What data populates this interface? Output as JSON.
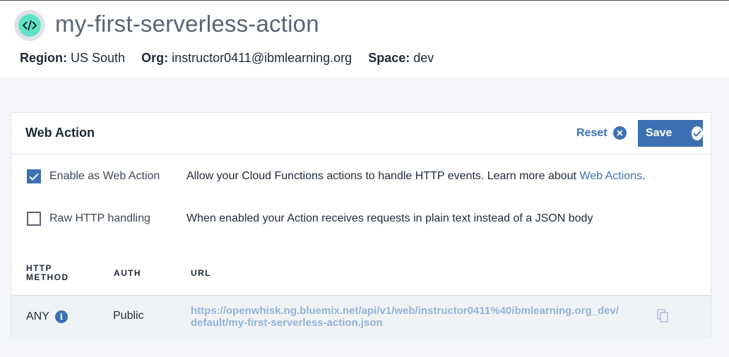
{
  "header": {
    "title": "my-first-serverless-action",
    "region_label": "Region:",
    "region_value": "US South",
    "org_label": "Org:",
    "org_value": "instructor0411@ibmlearning.org",
    "space_label": "Space:",
    "space_value": "dev",
    "logo_icon": "code-brackets-icon"
  },
  "card": {
    "title": "Web Action",
    "reset_label": "Reset",
    "save_label": "Save",
    "options": [
      {
        "label": "Enable as Web Action",
        "checked": true,
        "description": "Allow your Cloud Functions actions to handle HTTP events. Learn more about ",
        "link_text": "Web Actions",
        "suffix": "."
      },
      {
        "label": "Raw HTTP handling",
        "checked": false,
        "description": "When enabled your Action receives requests in plain text instead of a JSON body"
      }
    ],
    "table": {
      "headers": {
        "method_line1": "HTTP",
        "method_line2": "METHOD",
        "auth": "AUTH",
        "url": "URL"
      },
      "rows": [
        {
          "method": "ANY",
          "auth": "Public",
          "url": "https://openwhisk.ng.bluemix.net/api/v1/web/instructor0411%40ibmlearning.org_dev/default/my-first-serverless-action.json"
        }
      ]
    }
  },
  "colors": {
    "accent": "#3d70b2",
    "logo": "#5fe3c5",
    "url_text": "#94b4d6",
    "page_bg": "#f4f6f9"
  }
}
